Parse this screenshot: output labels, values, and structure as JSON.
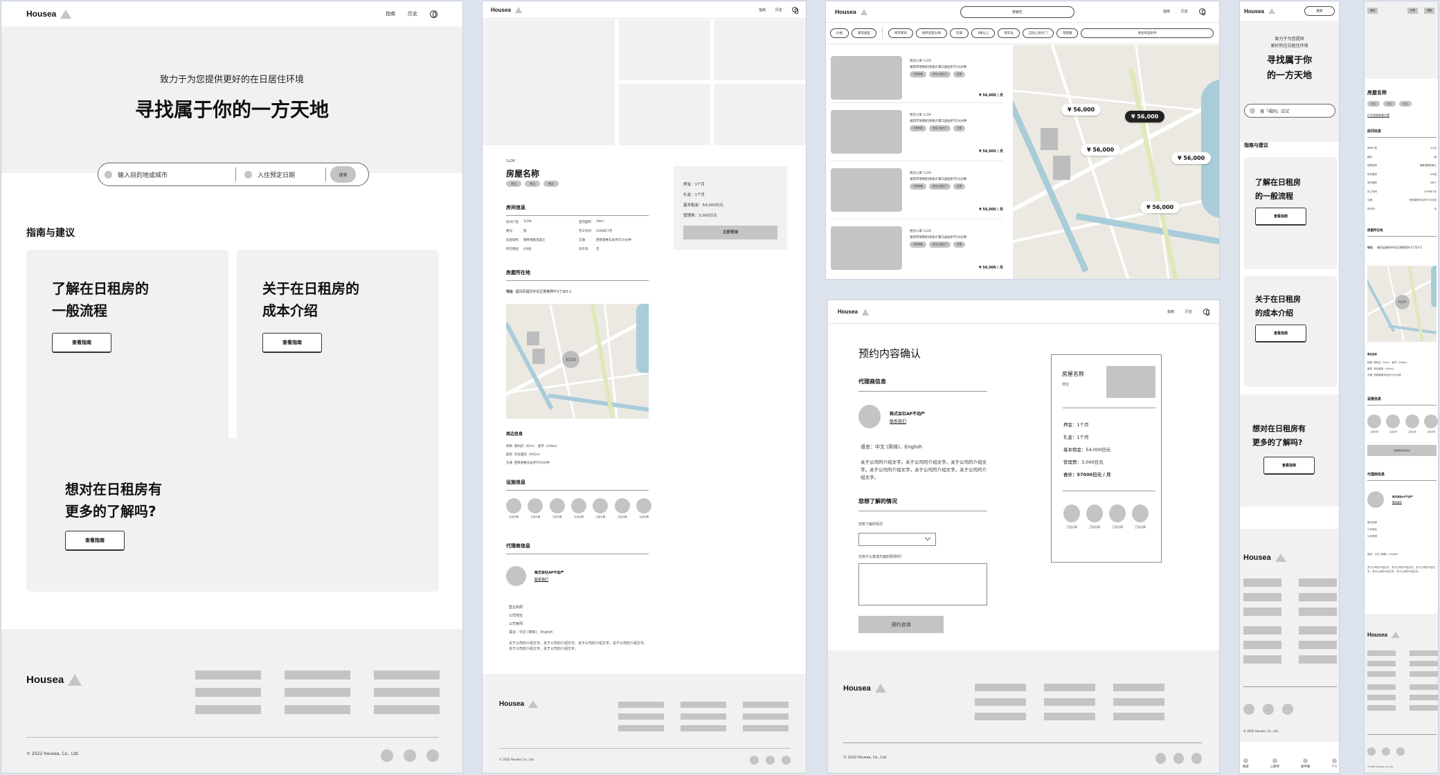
{
  "brand": "Housea",
  "nav": {
    "guide": "指南",
    "history": "历史"
  },
  "home": {
    "subtitle": "致力于为您提供更好的在日居住环境",
    "title": "寻找属于你的一方天地",
    "search": {
      "destination_placeholder": "输入目的地或城市",
      "date_placeholder": "入住预定日期",
      "button": "搜索"
    },
    "section_title": "指南与建议",
    "cards": [
      {
        "title_l1": "了解在日租房的",
        "title_l2": "一般流程",
        "button": "查看指南"
      },
      {
        "title_l1": "关于在日租房的",
        "title_l2": "成本介绍",
        "button": "查看指南"
      },
      {
        "title_l1": "想对在日租房有",
        "title_l2": "更多的了解吗?",
        "button": "查看指南"
      }
    ]
  },
  "footer": {
    "brand": "Housea",
    "copyright": "© 2022 Housea, Co., Ltd."
  },
  "detail": {
    "layout_tag": "1LDK",
    "name": "房屋名称",
    "tags": [
      "特点",
      "特点",
      "特点"
    ],
    "room_info_title": "房间信息",
    "room_info": [
      {
        "k": "房间户型",
        "v": "1LDK"
      },
      {
        "k": "室内面积",
        "v": "38m²"
      },
      {
        "k": "朝向",
        "v": "南"
      },
      {
        "k": "完工时间",
        "v": "2008年7月"
      },
      {
        "k": "房屋结构",
        "v": "钢骨钢筋混凝土"
      },
      {
        "k": "交通",
        "v": "西铁香椎车站步行20分钟"
      },
      {
        "k": "所在楼层",
        "v": "4/9层"
      },
      {
        "k": "驻车场",
        "v": "无"
      }
    ],
    "location_title": "房屋所在地",
    "address_label": "地址",
    "address": "福冈县福冈市东区香椎照叶3丁目3-1",
    "map_icon": "Icon",
    "nearby_title": "周边信息",
    "nearby": [
      {
        "k": "购物",
        "v": "便利店（92m） 超市（548m）"
      },
      {
        "k": "医院",
        "v": "综合医院（945m）"
      },
      {
        "k": "交通",
        "v": "西铁香椎车站步行20分钟"
      }
    ],
    "facilities_title": "设施信息",
    "facility_label": "卫浴分离",
    "agent_title": "代理商信息",
    "agent_name": "株式会社AP不动产",
    "contact": "联系我们",
    "agent_links": [
      "营业执照",
      "公司地址",
      "公司官网"
    ],
    "language": "语言：中文 (简体)、English",
    "intro": "关于公司的介绍文字。关于公司的介绍文字。关于公司的介绍文字。关于公司的介绍文字。关于公司的介绍文字。关于公司的介绍文字。",
    "price_box": {
      "deposit": "押金：1个月",
      "key_money": "礼金：1个月",
      "rent": "基本租金：54,000日元",
      "management": "管理费：3,000日元",
      "button": "立即咨询"
    }
  },
  "search_page": {
    "search_placeholder": "搜索栏",
    "filters_a": [
      "价格",
      "建筑类型"
    ],
    "filters_b": [
      "附带家具",
      "厕所浴室分离",
      "空调",
      "2楼以上",
      "停车位",
      "自动上锁大门",
      "宅配箱"
    ],
    "more_filters": "更多筛选条件",
    "listings": [
      {
        "type": "楼层公寓  1LDK",
        "access": "福冈市地铁机场线大濠口园站步行14分钟",
        "tags": [
          "木质地板",
          "自动上锁大门",
          "空调"
        ],
        "price": "¥ 56,000 / 月"
      },
      {
        "type": "楼层公寓  1LDK",
        "access": "福冈市地铁机场线大濠口园站步行14分钟",
        "tags": [
          "木质地板",
          "自动上锁大门",
          "空调"
        ],
        "price": "¥ 56,000 / 月"
      },
      {
        "type": "楼层公寓  1LDK",
        "access": "福冈市地铁机场线大濠口园站步行14分钟",
        "tags": [
          "木质地板",
          "自动上锁大门",
          "空调"
        ],
        "price": "¥ 56,000 / 月"
      },
      {
        "type": "楼层公寓  1LDK",
        "access": "福冈市地铁机场线大濠口园站步行14分钟",
        "tags": [
          "木质地板",
          "自动上锁大门",
          "空调"
        ],
        "price": "¥ 56,000 / 月"
      }
    ],
    "map_pins": [
      "¥ 56,000",
      "¥ 56,000",
      "¥ 56,000",
      "¥ 56,000",
      "¥ 56,000"
    ],
    "selected_pin_index": 1
  },
  "booking": {
    "title": "预约内容确认",
    "agent_title": "代理商信息",
    "agent_name": "株式会社AP不动产",
    "contact": "联系我们",
    "language": "语言：中文 (简体)、English",
    "intro": "关于公司的介绍文字。关于公司的介绍文字。关于公司的介绍文字。关于公司的介绍文字。关于公司的介绍文字。关于公司的介绍文字。",
    "inquiry_title": "您想了解的情况",
    "select_label": "您想了解的情况",
    "select_value": "",
    "textarea_label": "还有什么其他方面的顾虑吗?",
    "textarea_value": "",
    "submit": "预约咨询",
    "summary": {
      "name": "房屋名称",
      "address": "地址",
      "deposit": "押金：1个月",
      "key_money": "礼金：1个月",
      "rent": "基本租金：54,000日元",
      "management": "管理费：3,000日元",
      "total": "合计：57000日元 / 月",
      "facility_label": "卫浴分离"
    }
  },
  "mobile_home": {
    "search_button": "搜索",
    "subtitle_l1": "致力于为您提供",
    "subtitle_l2": "更好的在日居住环境",
    "title_l1": "寻找属于你",
    "title_l2": "的一方天地",
    "search_placeholder": "搜「福冈」试试",
    "section_title": "指南与建议",
    "cards": [
      {
        "title_l1": "了解在日租房",
        "title_l2": "的一般流程",
        "button": "查看指南"
      },
      {
        "title_l1": "关于在日租房",
        "title_l2": "的成本介绍",
        "button": "查看指南"
      },
      {
        "title_l1": "想对在日租房有",
        "title_l2": "更多的了解吗?",
        "button": "查看指南"
      }
    ],
    "tabbar": [
      "搜索",
      "心愿单",
      "收件箱",
      "个人"
    ]
  },
  "mobile_detail": {
    "back": "返回",
    "share": "分享",
    "favorite": "收藏",
    "name": "房屋名称",
    "tags": [
      "特点",
      "特点",
      "特点"
    ],
    "map_link": "打开地图查看位置",
    "room_info_title": "房间信息",
    "room_info": [
      {
        "k": "房间户型",
        "v": "1LDK"
      },
      {
        "k": "朝向",
        "v": "南"
      },
      {
        "k": "房屋结构",
        "v": "钢骨钢筋混凝土"
      },
      {
        "k": "所在楼层",
        "v": "4/9层"
      },
      {
        "k": "室内面积",
        "v": "38m²"
      },
      {
        "k": "完工时间",
        "v": "2008年7月"
      },
      {
        "k": "交通",
        "v": "西铁香椎车站步行20分钟"
      },
      {
        "k": "驻车场",
        "v": "无"
      }
    ],
    "location_title": "房屋所在地",
    "address_label": "地址",
    "address": "福冈县福冈市东区香椎照叶3丁目3-1",
    "map_icon": "Icon",
    "nearby_title": "周边信息",
    "nearby": [
      {
        "k": "购物",
        "v": "便利店（92m） 超市（548m）"
      },
      {
        "k": "医院",
        "v": "综合医院（945m）"
      },
      {
        "k": "交通",
        "v": "西铁香椎车站步行20分钟"
      }
    ],
    "facilities_title": "设施信息",
    "facility_label": "卫浴分离",
    "more_facilities": "查看更多设施信息",
    "agent_title": "代理商信息",
    "agent_name": "株式会社AP不动产",
    "contact": "联系我们",
    "agent_links": [
      "营业执照",
      "公司地址",
      "公司官网"
    ],
    "language": "语言：中文 (简体)、English",
    "intro": "关于公司的介绍文字。关于公司的介绍文字。关于公司的介绍文字。关于公司的介绍文字。关于公司的介绍文字。"
  }
}
